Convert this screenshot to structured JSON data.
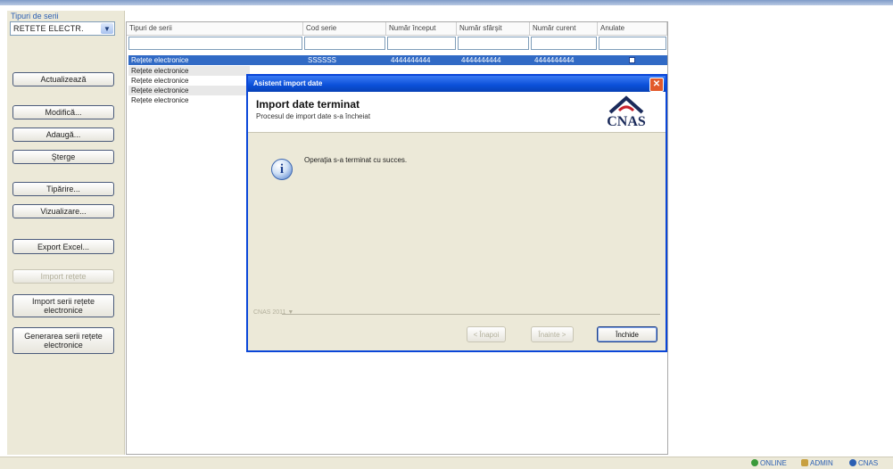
{
  "left_panel": {
    "filter_label": "Tipuri de serii",
    "filter_value": "RETETE ELECTR.",
    "buttons": {
      "refresh": "Actualizează",
      "modify": "Modifică...",
      "add": "Adaugă...",
      "delete": "Şterge",
      "print": "Tipărire...",
      "preview": "Vizualizare...",
      "export_excel": "Export Excel...",
      "import_prescriptions": "Import rețete",
      "import_series": "Import serii rețete electronice",
      "generate_series": "Generarea serii rețete electronice"
    }
  },
  "grid": {
    "columns": [
      "Tipuri de serii",
      "Cod serie",
      "Număr început",
      "Număr sfârşit",
      "Număr curent",
      "Anulate"
    ],
    "rows": [
      {
        "tip": "Rețete electronice",
        "cod": "SSSSSS",
        "inceput": "4444444444",
        "sfarsit": "4444444444",
        "curent": "4444444444",
        "anulate": true,
        "selected": true
      },
      {
        "tip": "Rețete electronice"
      },
      {
        "tip": "Rețete electronice"
      },
      {
        "tip": "Rețete electronice"
      },
      {
        "tip": "Rețete electronice"
      }
    ]
  },
  "dialog": {
    "title": "Asistent import date",
    "heading": "Import date terminat",
    "subheading": "Procesul de import date s-a încheiat",
    "logo_text": "CNAS",
    "message": "Operaţia s-a terminat cu succes.",
    "separator_label": "CNAS 2011 ▼",
    "buttons": {
      "back": "< Înapoi",
      "next": "Înainte >",
      "close": "Închide"
    }
  },
  "status_bar": {
    "online": "ONLINE",
    "user": "ADMIN",
    "org": "CNAS"
  },
  "colors": {
    "title_bar": "#0a4fd8",
    "selection": "#316ac5",
    "panel_bg": "#ece9d8"
  }
}
